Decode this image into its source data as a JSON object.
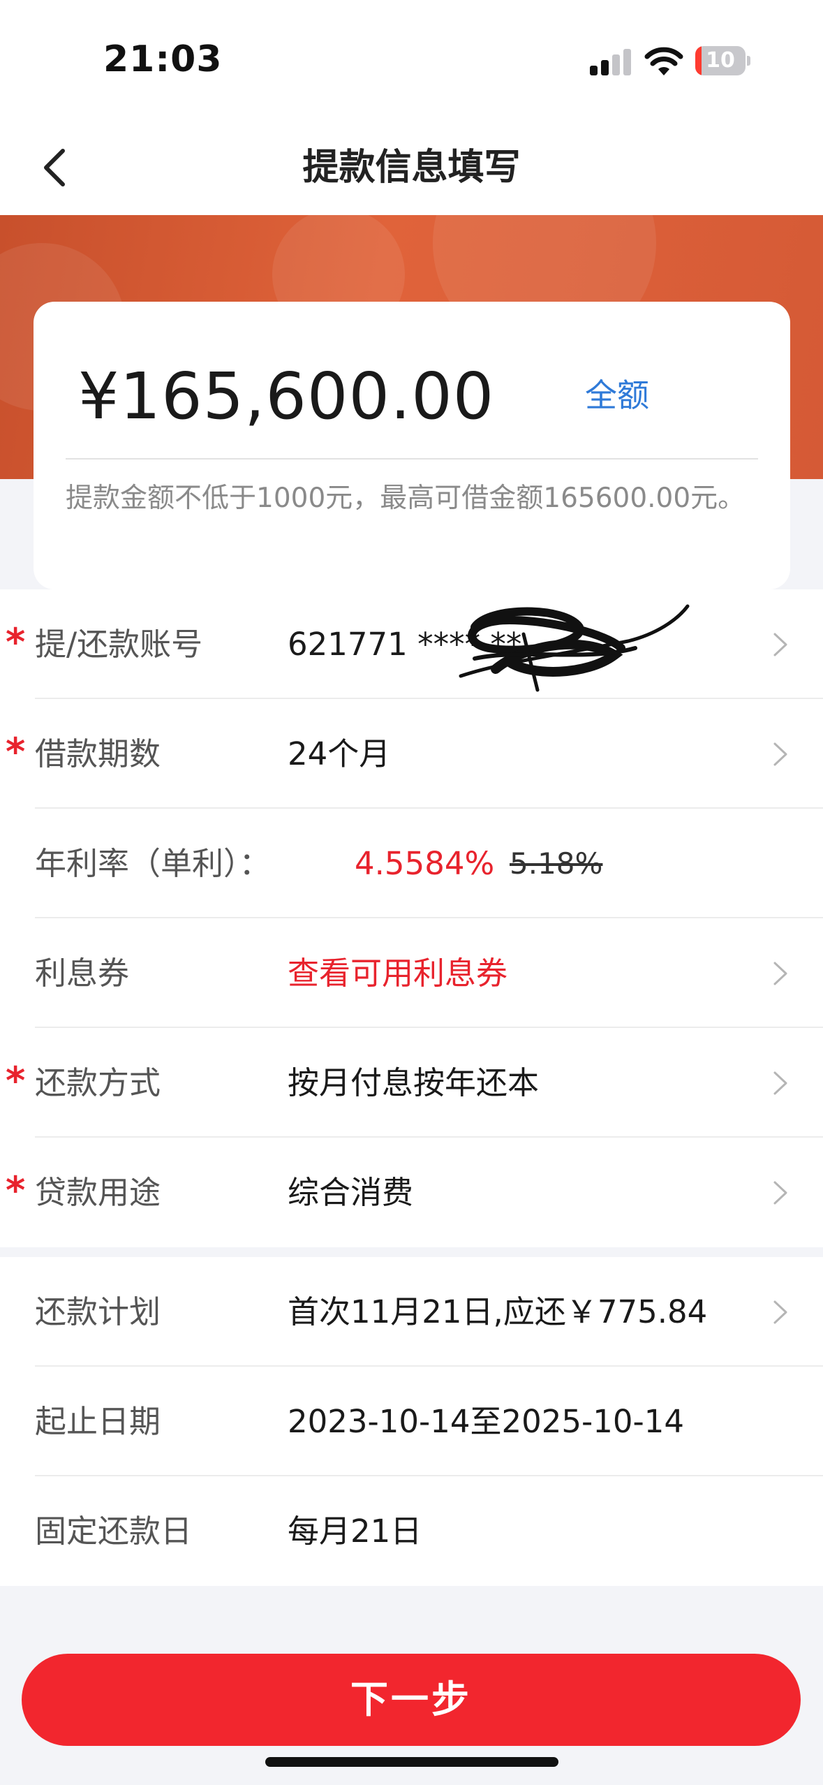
{
  "status_bar": {
    "time": "21:03",
    "battery": "10"
  },
  "header": {
    "title": "提款信息填写"
  },
  "amount_card": {
    "amount": "¥165,600.00",
    "full_amount_label": "全额",
    "hint": "提款金额不低于1000元，最高可借金额165600.00元。"
  },
  "form": {
    "account": {
      "label": "提/还款账号",
      "value": "621771 **** **"
    },
    "term": {
      "label": "借款期数",
      "value": "24个月"
    },
    "rate": {
      "label": "年利率（单利）：",
      "current": "4.5584%",
      "original": "5.18%"
    },
    "coupon": {
      "label": "利息券",
      "value": "查看可用利息券"
    },
    "repay_method": {
      "label": "还款方式",
      "value": "按月付息按年还本"
    },
    "purpose": {
      "label": "贷款用途",
      "value": "综合消费"
    }
  },
  "schedule": {
    "plan": {
      "label": "还款计划",
      "value": "首次11月21日,应还￥775.84"
    },
    "period": {
      "label": "起止日期",
      "value": "2023-10-14至2025-10-14"
    },
    "fixed_day": {
      "label": "固定还款日",
      "value": "每月21日"
    }
  },
  "footer": {
    "next_label": "下一步"
  },
  "colors": {
    "accent_red": "#e8232d",
    "button_red": "#f2262e",
    "banner_orange": "#d55a36",
    "link_blue": "#2f7ad8"
  }
}
